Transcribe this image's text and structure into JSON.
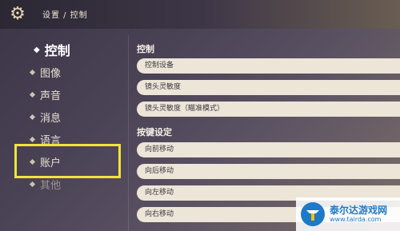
{
  "header": {
    "breadcrumb": "设置 / 控制",
    "settings_icon": "gear-icon"
  },
  "nav": {
    "items": [
      {
        "label": "控制",
        "state": "active"
      },
      {
        "label": "图像",
        "state": "normal"
      },
      {
        "label": "声音",
        "state": "normal"
      },
      {
        "label": "消息",
        "state": "normal"
      },
      {
        "label": "语言",
        "state": "normal"
      },
      {
        "label": "账户",
        "state": "highlighted"
      },
      {
        "label": "其他",
        "state": "dim"
      }
    ],
    "highlight_color": "#f2e33b"
  },
  "main": {
    "section1": {
      "title": "控制",
      "rows": [
        "控制设备",
        "镜头灵敏度",
        "镜头灵敏度（瞄准模式）"
      ]
    },
    "section2": {
      "title": "按键设定",
      "rows": [
        "向前移动",
        "向后移动",
        "向左移动",
        "向右移动"
      ]
    }
  },
  "watermark": {
    "name": "泰尔达游戏网",
    "url": "www.tairda.com"
  }
}
